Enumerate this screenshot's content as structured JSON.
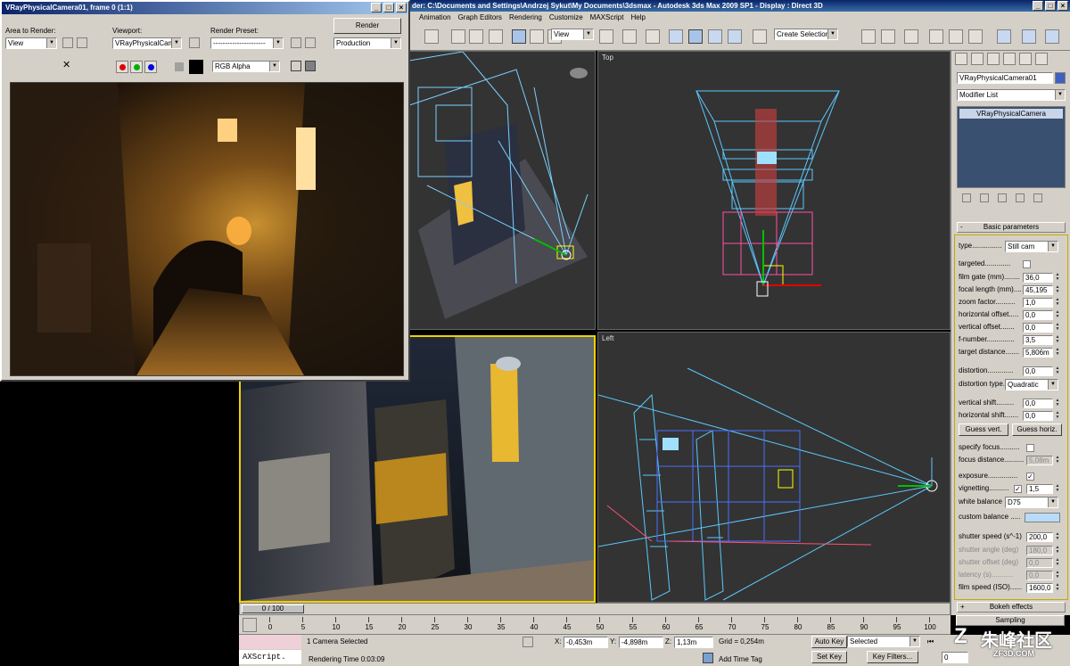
{
  "app": {
    "title": "der: C:\\Documents and Settings\\Andrzej Sykut\\My Documents\\3dsmax    - Autodesk 3ds Max  2009 SP1      - Display : Direct 3D",
    "win_min": "_",
    "win_max": "□",
    "win_close": "×"
  },
  "menu": [
    "Animation",
    "Graph Editors",
    "Rendering",
    "Customize",
    "MAXScript",
    "Help"
  ],
  "toolbar": {
    "ref_coord": "View",
    "selection_set": "Create Selection Se"
  },
  "render_window": {
    "title": "VRayPhysicalCamera01, frame 0 (1:1)",
    "area_label": "Area to Render:",
    "area_value": "View",
    "viewport_label": "Viewport:",
    "viewport_value": "VRayPhysicalCam",
    "preset_label": "Render Preset:",
    "preset_value": "----------------------",
    "render_button": "Render",
    "mode_value": "Production",
    "channel_value": "RGB Alpha",
    "colors": {
      "red": "#e00000",
      "green": "#00b000",
      "blue": "#0000e0"
    }
  },
  "viewports": {
    "top_label": "Top",
    "left_label": "Left"
  },
  "command_panel": {
    "object_name": "VRayPhysicalCamera01",
    "modifier_list": "Modifier List",
    "stack_item": "VRayPhysicalCamera",
    "basic_rollout": "Basic parameters",
    "rollout_minus": "-",
    "params": {
      "type_label": "type...............",
      "type_value": "Still cam",
      "targeted_label": "targeted.............",
      "film_gate_label": "film gate (mm)........",
      "film_gate_value": "36,0",
      "focal_length_label": "focal length (mm)....",
      "focal_length_value": "45,195",
      "zoom_factor_label": "zoom factor..........",
      "zoom_factor_value": "1,0",
      "h_offset_label": "horizontal offset.....",
      "h_offset_value": "0,0",
      "v_offset_label": "vertical offset.......",
      "v_offset_value": "0,0",
      "fnumber_label": "f-number..............",
      "fnumber_value": "3,5",
      "target_distance_label": "target distance.......",
      "target_distance_value": "5,806m",
      "distortion_label": "distortion.............",
      "distortion_value": "0,0",
      "distortion_type_label": "distortion type.",
      "distortion_type_value": "Quadratic",
      "v_shift_label": "vertical shift.........",
      "v_shift_value": "0,0",
      "h_shift_label": "horizontal shift.......",
      "h_shift_value": "0,0",
      "guess_vert": "Guess vert.",
      "guess_horiz": "Guess horiz.",
      "specify_focus_label": "specify focus..........",
      "focus_distance_label": "focus distance..........",
      "focus_distance_value": "5,08m",
      "exposure_label": "exposure...............",
      "vignetting_label": "vignetting..........",
      "vignetting_value": "1,5",
      "white_balance_label": "white balance",
      "white_balance_value": "D75",
      "custom_balance_label": "custom balance .....",
      "custom_balance_color": "#b8dcf8",
      "shutter_speed_label": "shutter speed (s^-1)",
      "shutter_speed_value": "200,0",
      "shutter_angle_label": "shutter angle (deg)",
      "shutter_angle_value": "180,0",
      "shutter_offset_label": "shutter offset (deg)",
      "shutter_offset_value": "0,0",
      "latency_label": "latency (s)...........",
      "latency_value": "0,0",
      "film_speed_label": "film speed (ISO)......",
      "film_speed_value": "1600,0",
      "check_mark": "✓"
    },
    "bokeh_rollout": "Bokeh effects",
    "bokeh_plus": "+",
    "sampling_rollout": "Sampling"
  },
  "timeline": {
    "position": "0 / 100",
    "ticks": [
      "0",
      "5",
      "10",
      "15",
      "20",
      "25",
      "30",
      "35",
      "40",
      "45",
      "50",
      "55",
      "60",
      "65",
      "70",
      "75",
      "80",
      "85",
      "90",
      "95",
      "100"
    ]
  },
  "status": {
    "maxscript": "AXScript.",
    "selected": "1 Camera Selected",
    "x_label": "X:",
    "x_value": "-0,453m",
    "y_label": "Y:",
    "y_value": "-4,898m",
    "z_label": "Z:",
    "z_value": "1,13m",
    "grid": "Grid = 0,254m",
    "render_time": "Rendering Time  0:03:09",
    "add_time_tag": "Add Time Tag",
    "auto_key": "Auto Key",
    "selected_combo": "Selected",
    "set_key": "Set Key",
    "key_filters": "Key Filters...",
    "frame": "0"
  },
  "watermark": {
    "text": "朱峰社区",
    "url": "ZF3D.COM"
  }
}
